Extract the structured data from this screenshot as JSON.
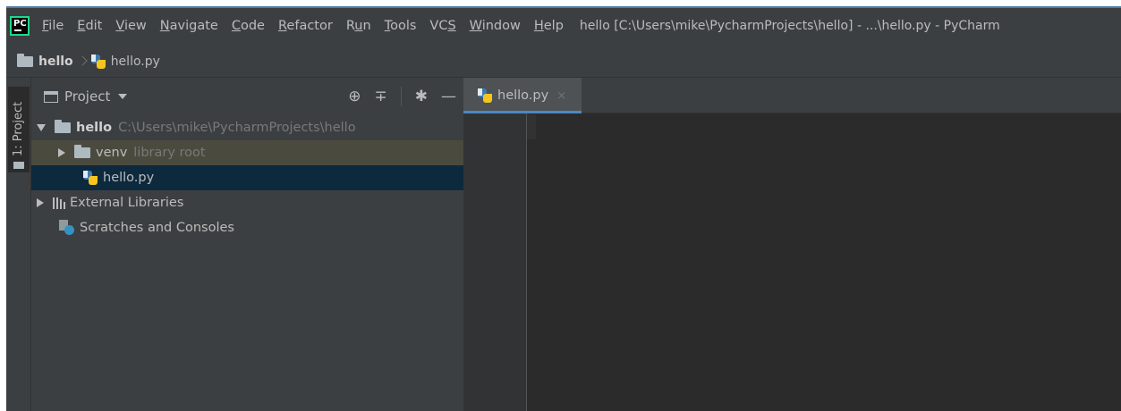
{
  "app": {
    "logo_text": "PC",
    "title": "hello [C:\\Users\\mike\\PycharmProjects\\hello] - ...\\hello.py - PyCharm"
  },
  "menu": [
    {
      "u": "F",
      "rest": "ile"
    },
    {
      "u": "E",
      "rest": "dit"
    },
    {
      "u": "V",
      "rest": "iew"
    },
    {
      "u": "N",
      "rest": "avigate"
    },
    {
      "u": "C",
      "rest": "ode"
    },
    {
      "u": "R",
      "rest": "efactor"
    },
    {
      "pre": "R",
      "u": "u",
      "rest": "n"
    },
    {
      "u": "T",
      "rest": "ools"
    },
    {
      "pre": "VC",
      "u": "S",
      "rest": ""
    },
    {
      "u": "W",
      "rest": "indow"
    },
    {
      "u": "H",
      "rest": "elp"
    }
  ],
  "breadcrumb": {
    "project": "hello",
    "file": "hello.py"
  },
  "tool_window": {
    "label": "1: Project"
  },
  "project_panel": {
    "title": "Project",
    "tools": {
      "locate": "⊕",
      "collapse": "∓",
      "settings": "✱",
      "hide": "—"
    },
    "tree": {
      "root_name": "hello",
      "root_path": "C:\\Users\\mike\\PycharmProjects\\hello",
      "venv_name": "venv",
      "venv_hint": "library root",
      "file_name": "hello.py",
      "external_libraries": "External Libraries",
      "scratches": "Scratches and Consoles"
    }
  },
  "editor": {
    "tab_label": "hello.py",
    "tab_close": "×"
  },
  "colors": {
    "window_bg": "#3c3f41",
    "editor_bg": "#2b2b2b",
    "selection": "#0d293e",
    "venv_highlight": "#4b4a3f",
    "accent": "#4a88c7"
  }
}
